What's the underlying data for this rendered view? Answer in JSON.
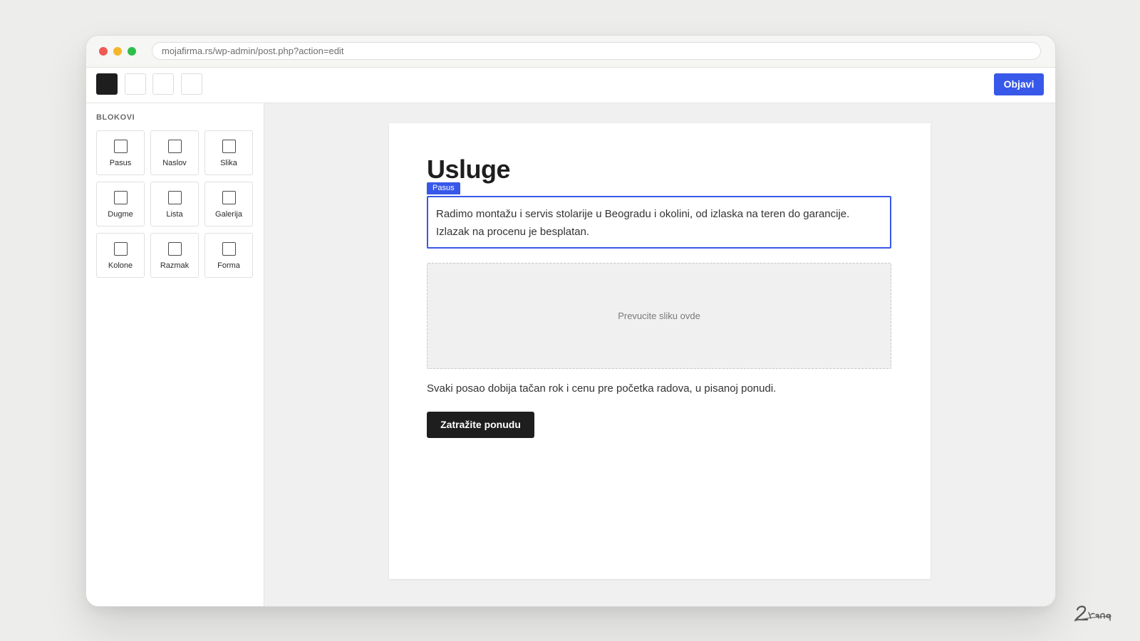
{
  "browser": {
    "url": "mojafirma.rs/wp-admin/post.php?action=edit"
  },
  "toolbar": {
    "tools": [
      "block-inserter-icon",
      "undo-icon",
      "redo-icon",
      "list-view-icon"
    ],
    "publish_label": "Objavi"
  },
  "sidebar": {
    "title": "BLOKOVI",
    "blocks": [
      {
        "label": "Pasus"
      },
      {
        "label": "Naslov"
      },
      {
        "label": "Slika"
      },
      {
        "label": "Dugme"
      },
      {
        "label": "Lista"
      },
      {
        "label": "Galerija"
      },
      {
        "label": "Kolone"
      },
      {
        "label": "Razmak"
      },
      {
        "label": "Forma"
      }
    ]
  },
  "editor": {
    "title": "Usluge",
    "selected_block_label": "Pasus",
    "paragraph": "Radimo montažu i servis stolarije u Beogradu i okolini, od izlaska na teren do garancije. Izlazak na procenu je besplatan.",
    "image_placeholder": "Prevucite sliku ovde",
    "body_text": "Svaki posao dobija tačan rok i cenu pre početka radova, u pisanoj ponudi.",
    "cta_label": "Zatražite ponudu"
  },
  "colors": {
    "accent": "#3858e9",
    "dark": "#1e1e1e",
    "canvas_bg": "#f0f0f0",
    "page_bg": "#ededeb"
  }
}
